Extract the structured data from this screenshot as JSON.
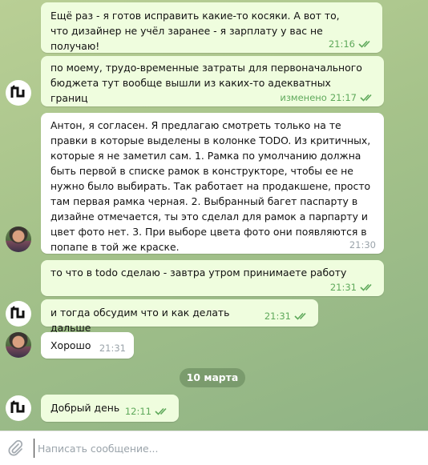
{
  "messages": [
    {
      "text": "Ещё раз - я готов исправить какие-то косяки. А вот то, что дизайнер не учёл заранее - я зарплату у вас не получаю!",
      "time": "21:16"
    },
    {
      "text": "по моему, трудо-временные затраты для первоначального бюджета тут вообще вышли из каких-то адекватных границ",
      "edited": "изменено",
      "time": "21:17"
    },
    {
      "text": "Антон, я согласен. Я предлагаю смотреть только на те правки в которые выделены в колонке TODO. Из критичных, которые я не заметил сам. 1. Рамка по умолчанию должна быть первой в списке рамок в конструкторе, чтобы ее не нужно было выбирать. Так работает на продакшене, просто там первая рамка черная. 2. Выбранный багет паспарту в дизайне отмечается, ты это сделал для рамок а парпарту и цвет фото нет. 3. При выборе цвета фото они появляются в попапе в той же краске.",
      "time": "21:30"
    },
    {
      "text": "то что в todo сделаю - завтра утром принимаете работу",
      "time": "21:31"
    },
    {
      "text": "и тогда обсудим что и как делать дальше",
      "time": "21:31"
    },
    {
      "text": "Хорошо",
      "time": "21:31"
    },
    {
      "text": "Добрый день",
      "time": "12:11"
    }
  ],
  "date_separator": "10 марта",
  "composer": {
    "placeholder": "Написать сообщение..."
  },
  "colors": {
    "outgoing_bubble": "#effdde",
    "incoming_bubble": "#ffffff",
    "read_check": "#5fa95b"
  }
}
